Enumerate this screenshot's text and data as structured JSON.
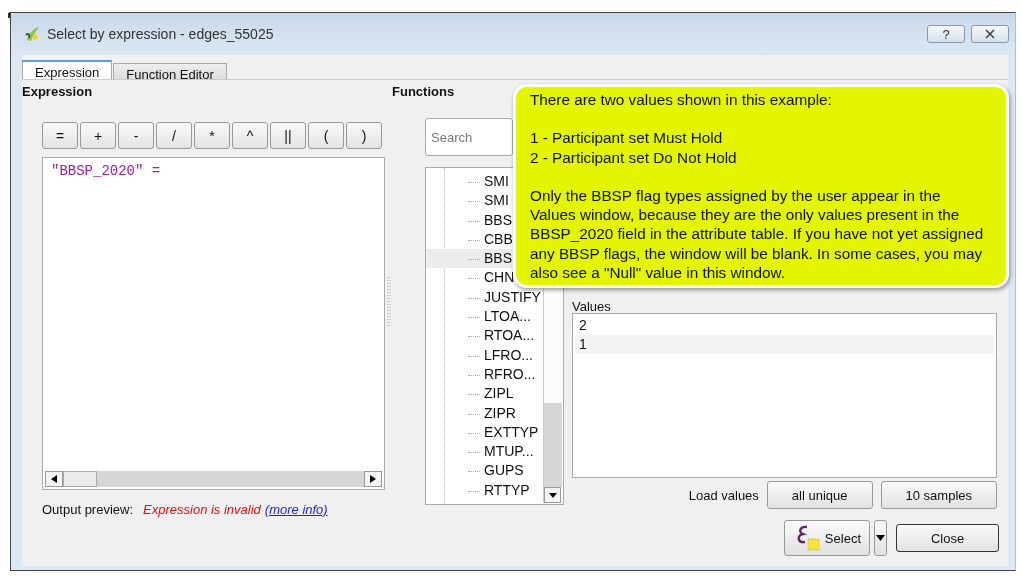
{
  "window": {
    "title": "Select by expression - edges_55025",
    "help_button": "?"
  },
  "tabs": [
    {
      "label": "Expression",
      "selected": true
    },
    {
      "label": "Function Editor",
      "selected": false
    }
  ],
  "expression_panel": {
    "heading": "Expression",
    "operators": [
      "=",
      "+",
      "-",
      "/",
      "*",
      "^",
      "||",
      "(",
      ")"
    ],
    "value": "\"BBSP_2020\" =",
    "output_label": "Output preview:",
    "error": "Expression is invalid",
    "link": "(more info)"
  },
  "functions_panel": {
    "heading": "Functions",
    "search": {
      "placeholder": "Search"
    },
    "items": [
      {
        "label": "SMI",
        "selected": false
      },
      {
        "label": "SMI",
        "selected": false
      },
      {
        "label": "BBS",
        "selected": false
      },
      {
        "label": "CBB",
        "selected": false
      },
      {
        "label": "BBS",
        "selected": true
      },
      {
        "label": "CHN",
        "selected": false
      },
      {
        "label": "JUSTIFY",
        "selected": false
      },
      {
        "label": "LTOA...",
        "selected": false
      },
      {
        "label": "RTOA...",
        "selected": false
      },
      {
        "label": "LFRO...",
        "selected": false
      },
      {
        "label": "RFRO...",
        "selected": false
      },
      {
        "label": "ZIPL",
        "selected": false
      },
      {
        "label": "ZIPR",
        "selected": false
      },
      {
        "label": "EXTTYP",
        "selected": false
      },
      {
        "label": "MTUP...",
        "selected": false
      },
      {
        "label": "GUPS",
        "selected": false
      },
      {
        "label": "RTTYP",
        "selected": false
      }
    ]
  },
  "values_panel": {
    "heading": "Values",
    "values": [
      "2",
      "1"
    ],
    "load_label": "Load values",
    "load_buttons": [
      "all unique",
      "10 samples"
    ]
  },
  "buttons": {
    "select": "Select",
    "close": "Close"
  },
  "callout": {
    "intro": "There are two values shown in this example:",
    "lines": [
      "1 - Participant set Must Hold",
      "2 - Participant set Do Not Hold"
    ],
    "body": "Only the BBSP flag types assigned by the user appear in the Values window, because they are the only values present in the BBSP_2020 field in the attribute table.  If you have not yet assigned any BBSP flags, the window will be blank. In some cases, you may also see a \"Null\" value in this window."
  }
}
